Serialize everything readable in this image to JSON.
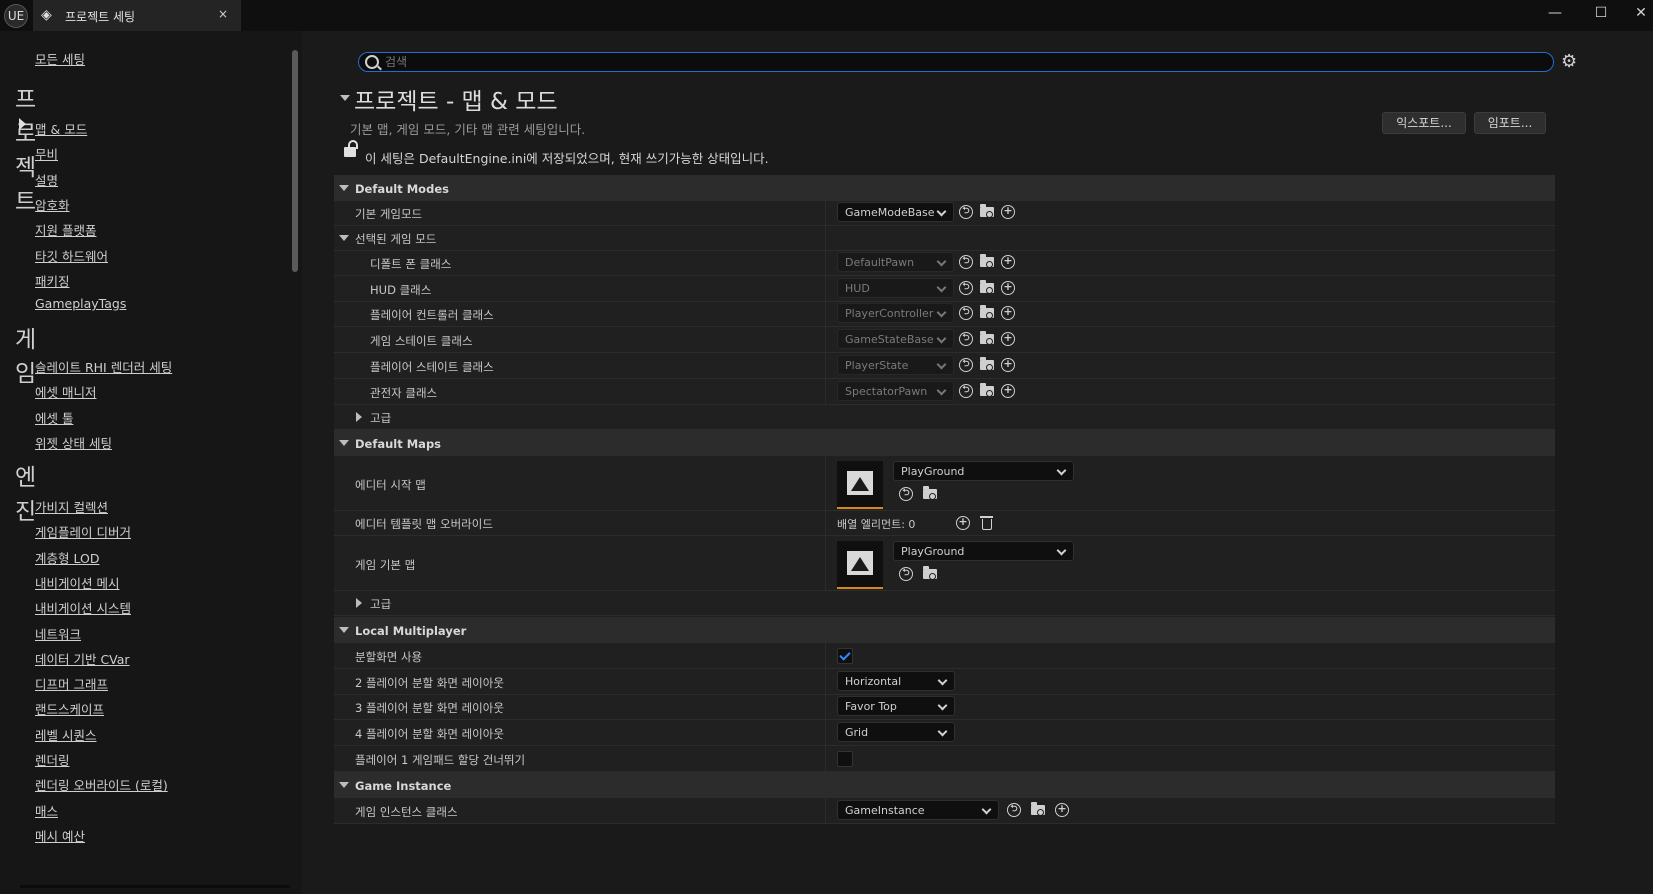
{
  "titlebar": {
    "logo": "UE",
    "tab_title": "프로젝트 세팅",
    "close": "×",
    "minimize": "—",
    "maximize": "☐",
    "window_close": "✕"
  },
  "sidebar": {
    "all_settings": "모든 세팅",
    "sections": [
      {
        "title": "프로젝트",
        "items": [
          "맵 & 모드",
          "무비",
          "설명",
          "암호화",
          "지원 플랫폼",
          "타깃 하드웨어",
          "패키징",
          "GameplayTags"
        ]
      },
      {
        "title": "게임",
        "items": [
          "슬레이트 RHI 렌더러 세팅",
          "에셋 매니저",
          "에셋 툴",
          "위젯 상태 세팅"
        ]
      },
      {
        "title": "엔진",
        "items": [
          "가비지 컬렉션",
          "게임플레이 디버거",
          "계층형 LOD",
          "내비게이션 메시",
          "내비게이션 시스템",
          "네트워크",
          "데이터 기반 CVar",
          "디프머 그래프",
          "랜드스케이프",
          "레벨 시퀀스",
          "렌더링",
          "렌더링 오버라이드 (로컬)",
          "매스",
          "메시 예산"
        ]
      }
    ]
  },
  "search": {
    "placeholder": "검색"
  },
  "header": {
    "title": "프로젝트 - 맵 & 모드",
    "subtitle": "기본 맵, 게임 모드, 기타 맵 관련 세팅입니다.",
    "export": "익스포트...",
    "import": "임포트...",
    "config_note": "이 세팅은 DefaultEngine.ini에 저장되었으며, 현재 쓰기가능한 상태입니다."
  },
  "default_modes": {
    "category": "Default Modes",
    "default_gamemode_label": "기본 게임모드",
    "default_gamemode_value": "GameModeBase",
    "selected_gamemode": "선택된 게임 모드",
    "sub_rows": [
      {
        "label": "디폴트 폰 클래스",
        "value": "DefaultPawn"
      },
      {
        "label": "HUD 클래스",
        "value": "HUD"
      },
      {
        "label": "플레이어 컨트롤러 클래스",
        "value": "PlayerController"
      },
      {
        "label": "게임 스테이트 클래스",
        "value": "GameStateBase"
      },
      {
        "label": "플레이어 스테이트 클래스",
        "value": "PlayerState"
      },
      {
        "label": "관전자 클래스",
        "value": "SpectatorPawn"
      }
    ],
    "advanced": "고급"
  },
  "default_maps": {
    "category": "Default Maps",
    "editor_startup_label": "에디터 시작 맵",
    "editor_startup_value": "PlayGround",
    "editor_template_label": "에디터 템플릿 맵 오버라이드",
    "array_elements": "배열 엘리먼트: 0",
    "game_default_label": "게임 기본 맵",
    "game_default_value": "PlayGround",
    "advanced": "고급"
  },
  "local_multiplayer": {
    "category": "Local Multiplayer",
    "split_screen_label": "분할화면 사용",
    "split_screen_checked": true,
    "two_player_label": "2 플레이어 분할 화면 레이아웃",
    "two_player_value": "Horizontal",
    "three_player_label": "3 플레이어 분할 화면 레이아웃",
    "three_player_value": "Favor Top",
    "four_player_label": "4 플레이어 분할 화면 레이아웃",
    "four_player_value": "Grid",
    "skip_gamepad_label": "플레이어 1 게임패드 할당 건너뛰기",
    "skip_gamepad_checked": false
  },
  "game_instance": {
    "category": "Game Instance",
    "label": "게임 인스턴스 클래스",
    "value": "GameInstance"
  },
  "icons": {
    "back": "⮌",
    "plus": "+",
    "gear": "⚙",
    "project": "◈"
  },
  "colors": {
    "accent_blue": "#1f6fd0",
    "asset_orange": "#d08a1c",
    "check_blue": "#2f8bff"
  }
}
